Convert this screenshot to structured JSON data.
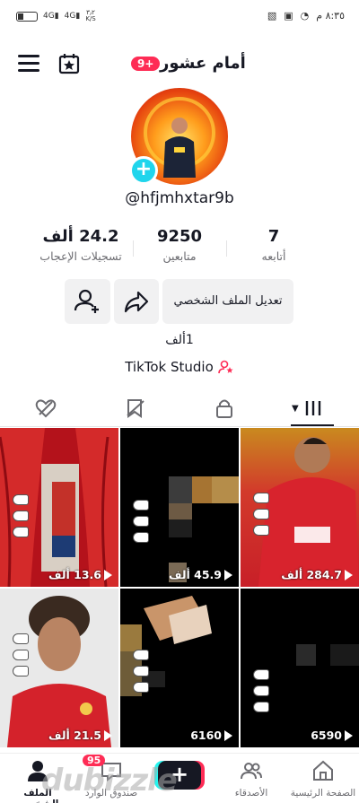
{
  "status_bar": {
    "time": "٨:٣٥ م",
    "network": "4G",
    "speed_top": "٣٫٢",
    "speed_unit": "K/S"
  },
  "header": {
    "title": "أمام عشور",
    "badge": "9+"
  },
  "profile": {
    "username": "@hfjmhxtar9b",
    "following_count": "7",
    "following_label": "أتابعه",
    "followers_count": "9250",
    "followers_label": "متابعين",
    "likes_count": "24.2 ألف",
    "likes_label": "تسجيلات الإعجاب",
    "edit_button": "تعديل الملف الشخصي",
    "bio": "1ألف",
    "studio_link": "TikTok Studio"
  },
  "videos": [
    {
      "views": "284.7 ألف"
    },
    {
      "views": "45.9 ألف"
    },
    {
      "views": "13.6 ألف"
    },
    {
      "views": "6590"
    },
    {
      "views": "6160"
    },
    {
      "views": "21.5 ألف"
    }
  ],
  "nav": {
    "home": "الصفحة الرئيسية",
    "friends": "الأصدقاء",
    "inbox": "صندوق الوارد",
    "inbox_badge": "95",
    "profile": "الملف الشخصي"
  },
  "watermark": "dubizzle",
  "colors": {
    "accent": "#fe2c55",
    "cyan": "#20d5ec",
    "text": "#161823",
    "muted": "#6b6b70"
  }
}
